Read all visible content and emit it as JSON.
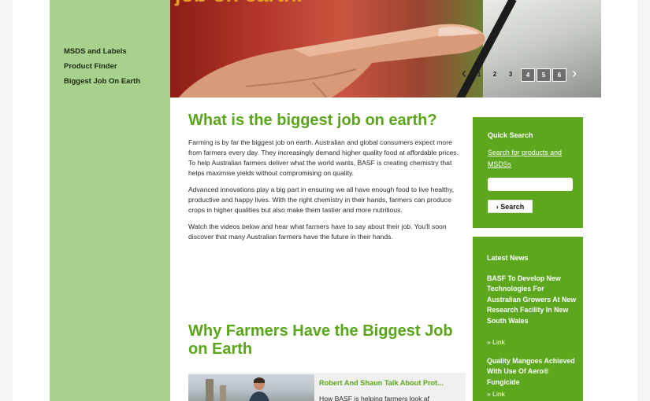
{
  "hero": {
    "headline": "job on earth.",
    "carousel": {
      "prev_symbol": "‹",
      "next_symbol": "›",
      "pages": [
        "1",
        "2",
        "3",
        "4",
        "5",
        "6"
      ],
      "active_page": "3"
    }
  },
  "sidebar": {
    "items": [
      {
        "label": "MSDS and Labels"
      },
      {
        "label": "Product Finder"
      },
      {
        "label": "Biggest Job On Earth"
      }
    ]
  },
  "main": {
    "title": "What is the biggest job on earth?",
    "paragraphs": [
      "Farming is by far the biggest job on earth. Australian and global consumers expect more from farmers every day. They increasingly demand higher quality food at affordable prices. To help Australian farmers deliver what the world wants, BASF is creating chemistry that helps maximise yields without compromising on quality.",
      "Advanced innovations play a big part in ensuring we all have enough food to live healthy, productive and happy lives. With the right chemistry in their hands, farmers can produce crops in higher qualities but also make them tastier and more nutritious.",
      "Watch the videos below and hear what farmers have to say about their job. You'll soon discover that many Australian farmers have the future in their hands."
    ],
    "section_title": "Why Farmers Have the Biggest Job on Earth",
    "video": {
      "title": "Robert And Shaun Talk About Prot...",
      "description": "How BASF is helping farmers look af"
    }
  },
  "quick_search": {
    "title": "Quick Search",
    "link": "Search for products and MSDSs",
    "input_value": "",
    "button_label": "› Search"
  },
  "latest_news": {
    "title": "Latest News",
    "items": [
      {
        "headline": "BASF To Develop New Technologies For Australian Growers At New Research Facility In New South Wales",
        "link": "»  Link"
      },
      {
        "headline": "Quality Mangoes Achieved With Use Of Aero® Fungicide",
        "link": "»  Link"
      }
    ]
  },
  "colors": {
    "brand_green": "#5da71f",
    "heading_green": "#5aa61a",
    "sidebar_green": "#a9d18e",
    "hero_headline": "#e89c2c"
  }
}
